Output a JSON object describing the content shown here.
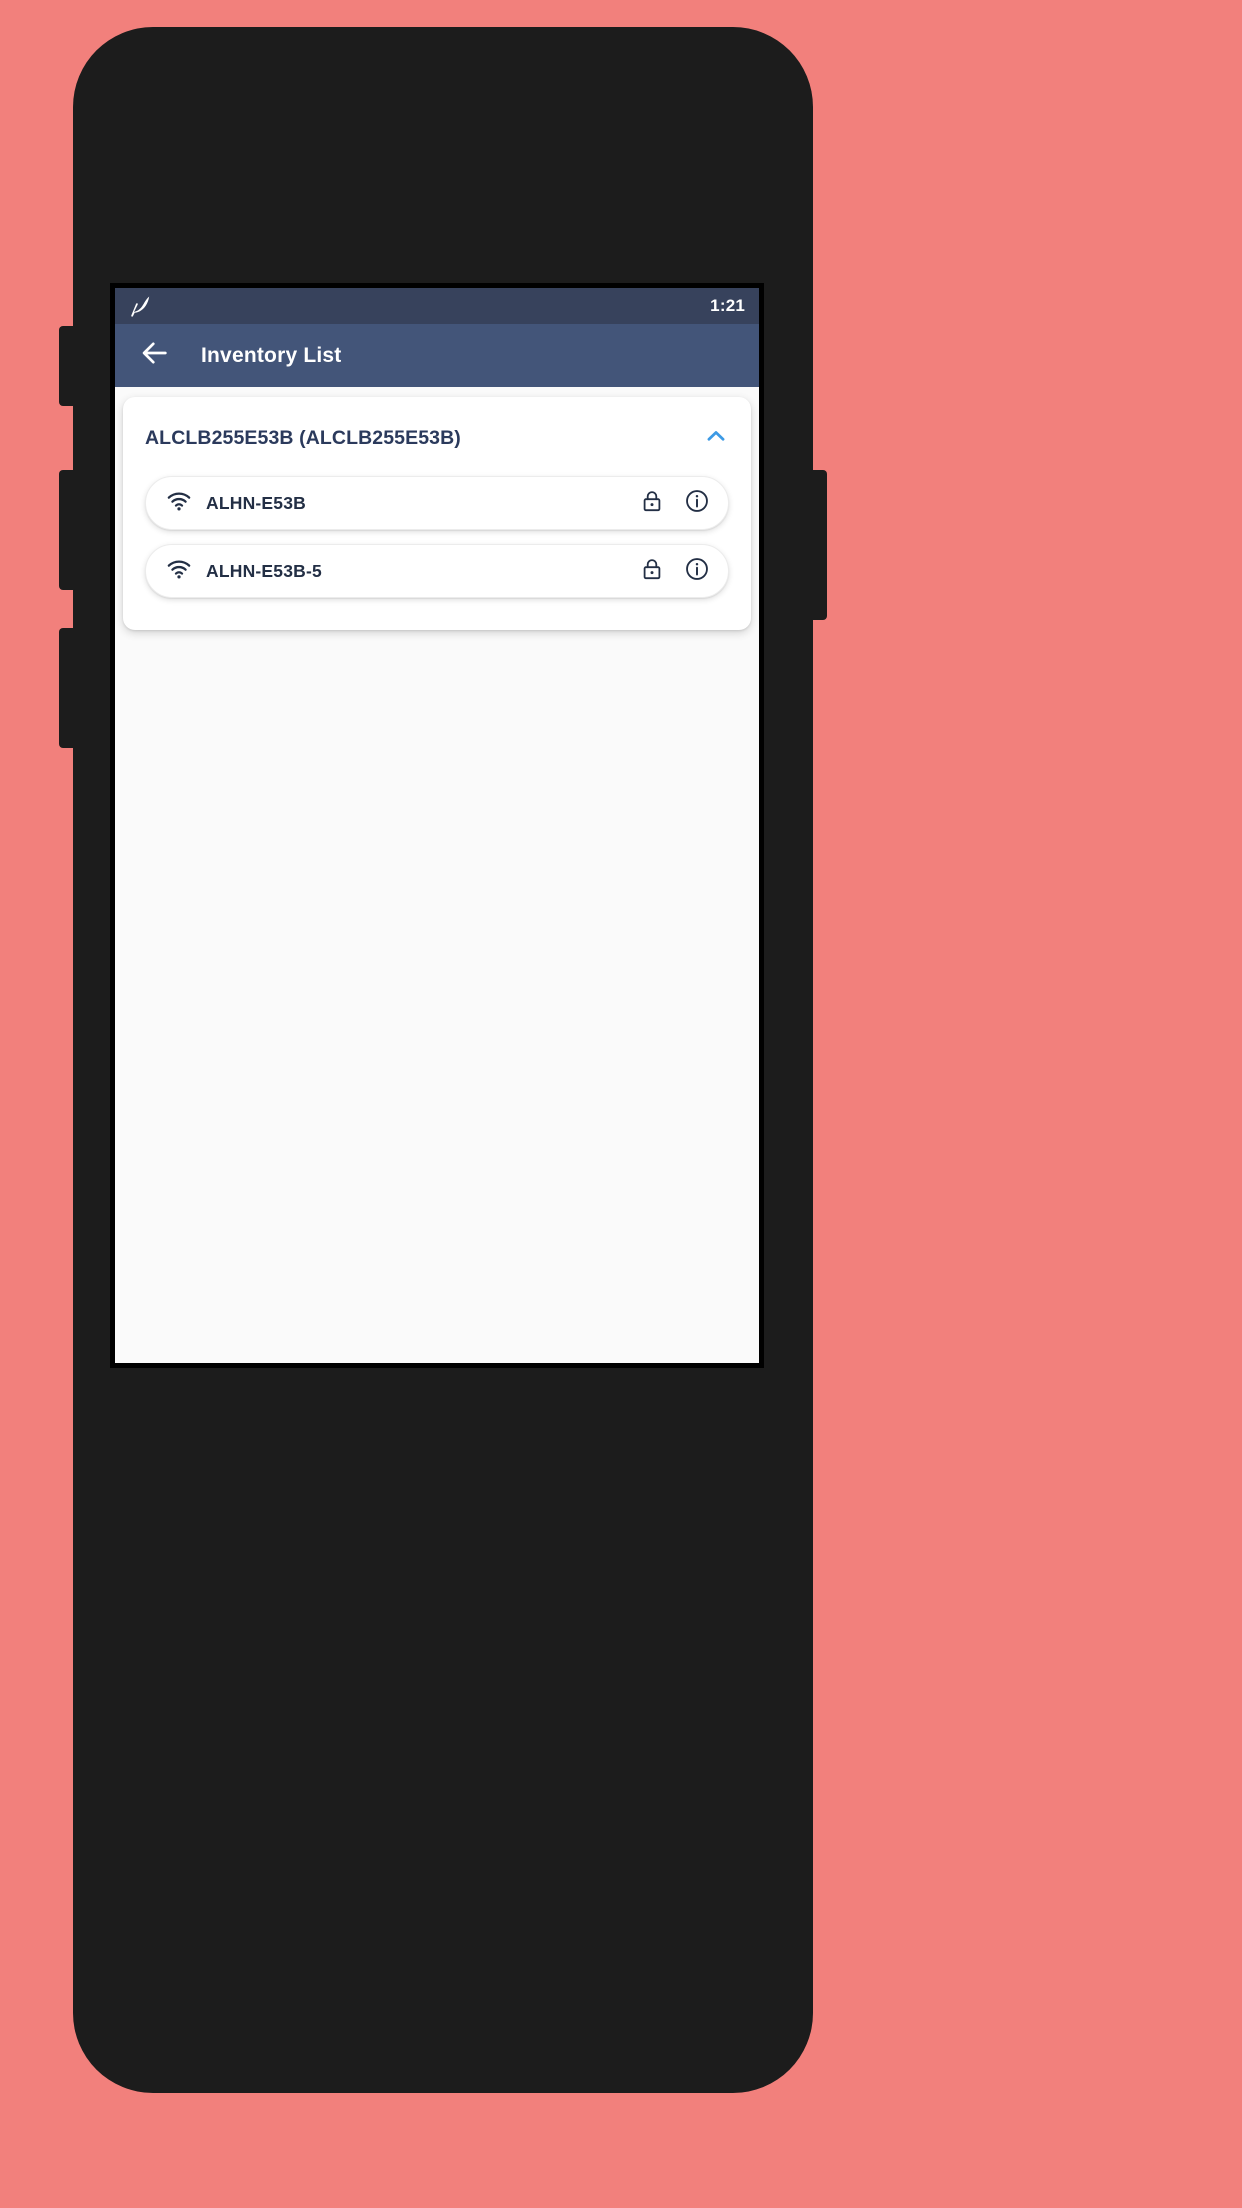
{
  "device": {
    "chassis_color": "#1c1c1c",
    "wallpaper_color": "#f2807c"
  },
  "statusbar": {
    "app_icon": "leaf-icon",
    "time": "1:21",
    "background": "#37425c"
  },
  "appbar": {
    "back_icon": "back-arrow-icon",
    "title": "Inventory List",
    "background": "#435579"
  },
  "content": {
    "group": {
      "title": "ALCLB255E53B (ALCLB255E53B)",
      "expanded": true,
      "toggle_icon": "chevron-up-icon",
      "toggle_icon_color": "#3d9ae5",
      "networks": [
        {
          "signal_icon": "wifi-icon",
          "ssid": "ALHN-E53B",
          "secured_icon": "lock-icon",
          "details_icon": "info-icon"
        },
        {
          "signal_icon": "wifi-icon",
          "ssid": "ALHN-E53B-5",
          "secured_icon": "lock-icon",
          "details_icon": "info-icon"
        }
      ]
    }
  },
  "colors": {
    "text_dark_navy": "#2b3a5c",
    "row_text": "#232f45",
    "accent_blue": "#3d9ae5",
    "screen_bg": "#fafafa"
  }
}
